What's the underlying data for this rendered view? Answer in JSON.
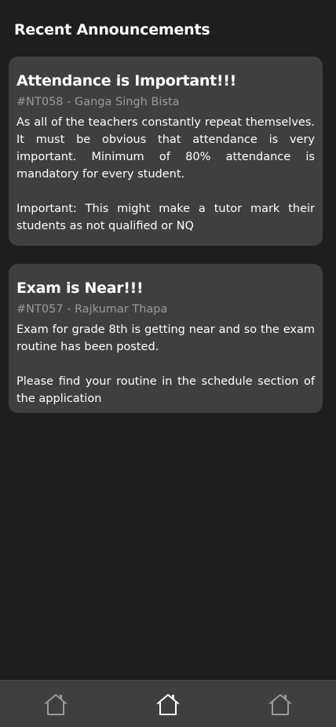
{
  "header": {
    "title": "Recent Announcements"
  },
  "announcements": [
    {
      "title": "Attendance is Important!!!",
      "meta": "#NT058 - Ganga Singh Bista",
      "paragraphs": [
        "As all of the teachers constantly repeat themselves. It must be obvious that attendance is very important. Minimum of 80% attendance is mandatory for every student.",
        "Important: This might make a tutor mark their students as not qualified or NQ"
      ]
    },
    {
      "title": "Exam is Near!!!",
      "meta": "#NT057 - Rajkumar Thapa",
      "paragraphs": [
        "Exam for grade 8th is getting near and so the exam routine has been posted.",
        "Please find your routine in the schedule section of the application"
      ]
    }
  ],
  "bottom_nav": {
    "items": [
      {
        "icon": "home-icon",
        "active": false
      },
      {
        "icon": "home-icon",
        "active": true
      },
      {
        "icon": "home-icon",
        "active": false
      }
    ]
  },
  "colors": {
    "background": "#1e1e1e",
    "card": "#3f3f3f",
    "meta_text": "#9a9a9a",
    "icon_inactive": "#9a9a9a",
    "icon_active": "#ffffff"
  }
}
